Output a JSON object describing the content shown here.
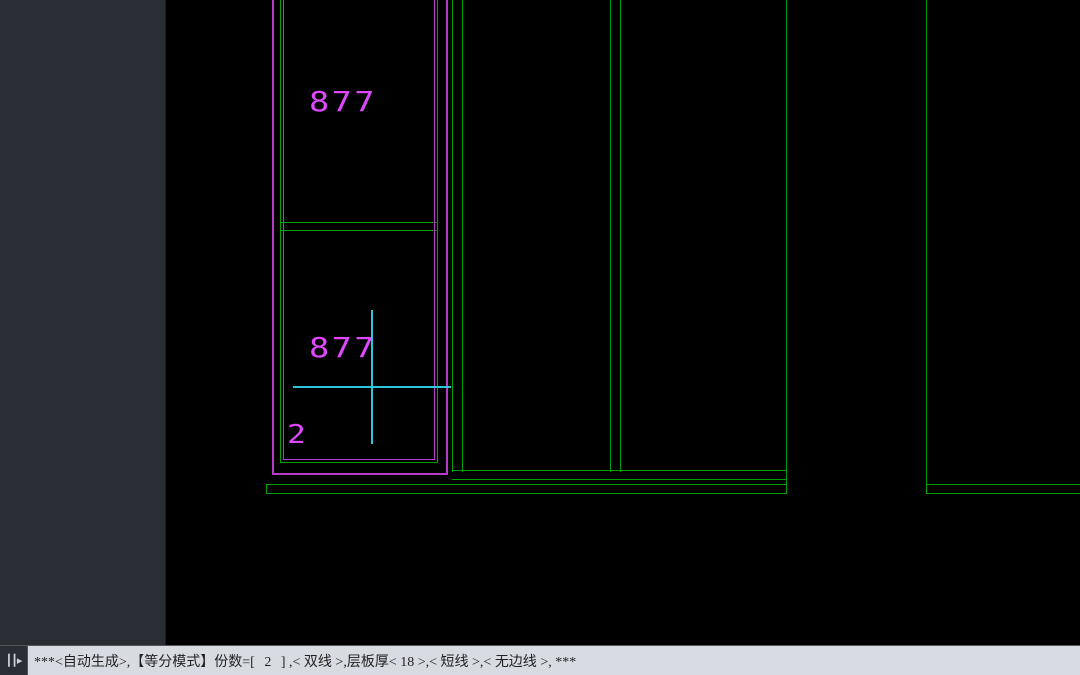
{
  "canvas": {
    "dim_upper": "877",
    "dim_lower": "877",
    "dim_left_small": "2"
  },
  "command": {
    "prefix": "***<自动生成>,【等分模式】份数=[",
    "value": " 2 ",
    "mid1": "] ,<",
    "opt_double": " 双线 ",
    "mid2": ">,层板厚<",
    "thickness": " 18 ",
    "mid3": ">,<",
    "opt_short": " 短线 ",
    "mid4": ">,<",
    "opt_noedge": " 无边线 ",
    "suffix": ">,  ***"
  },
  "icons": {
    "cmd_toggle": "┃┃▸"
  }
}
